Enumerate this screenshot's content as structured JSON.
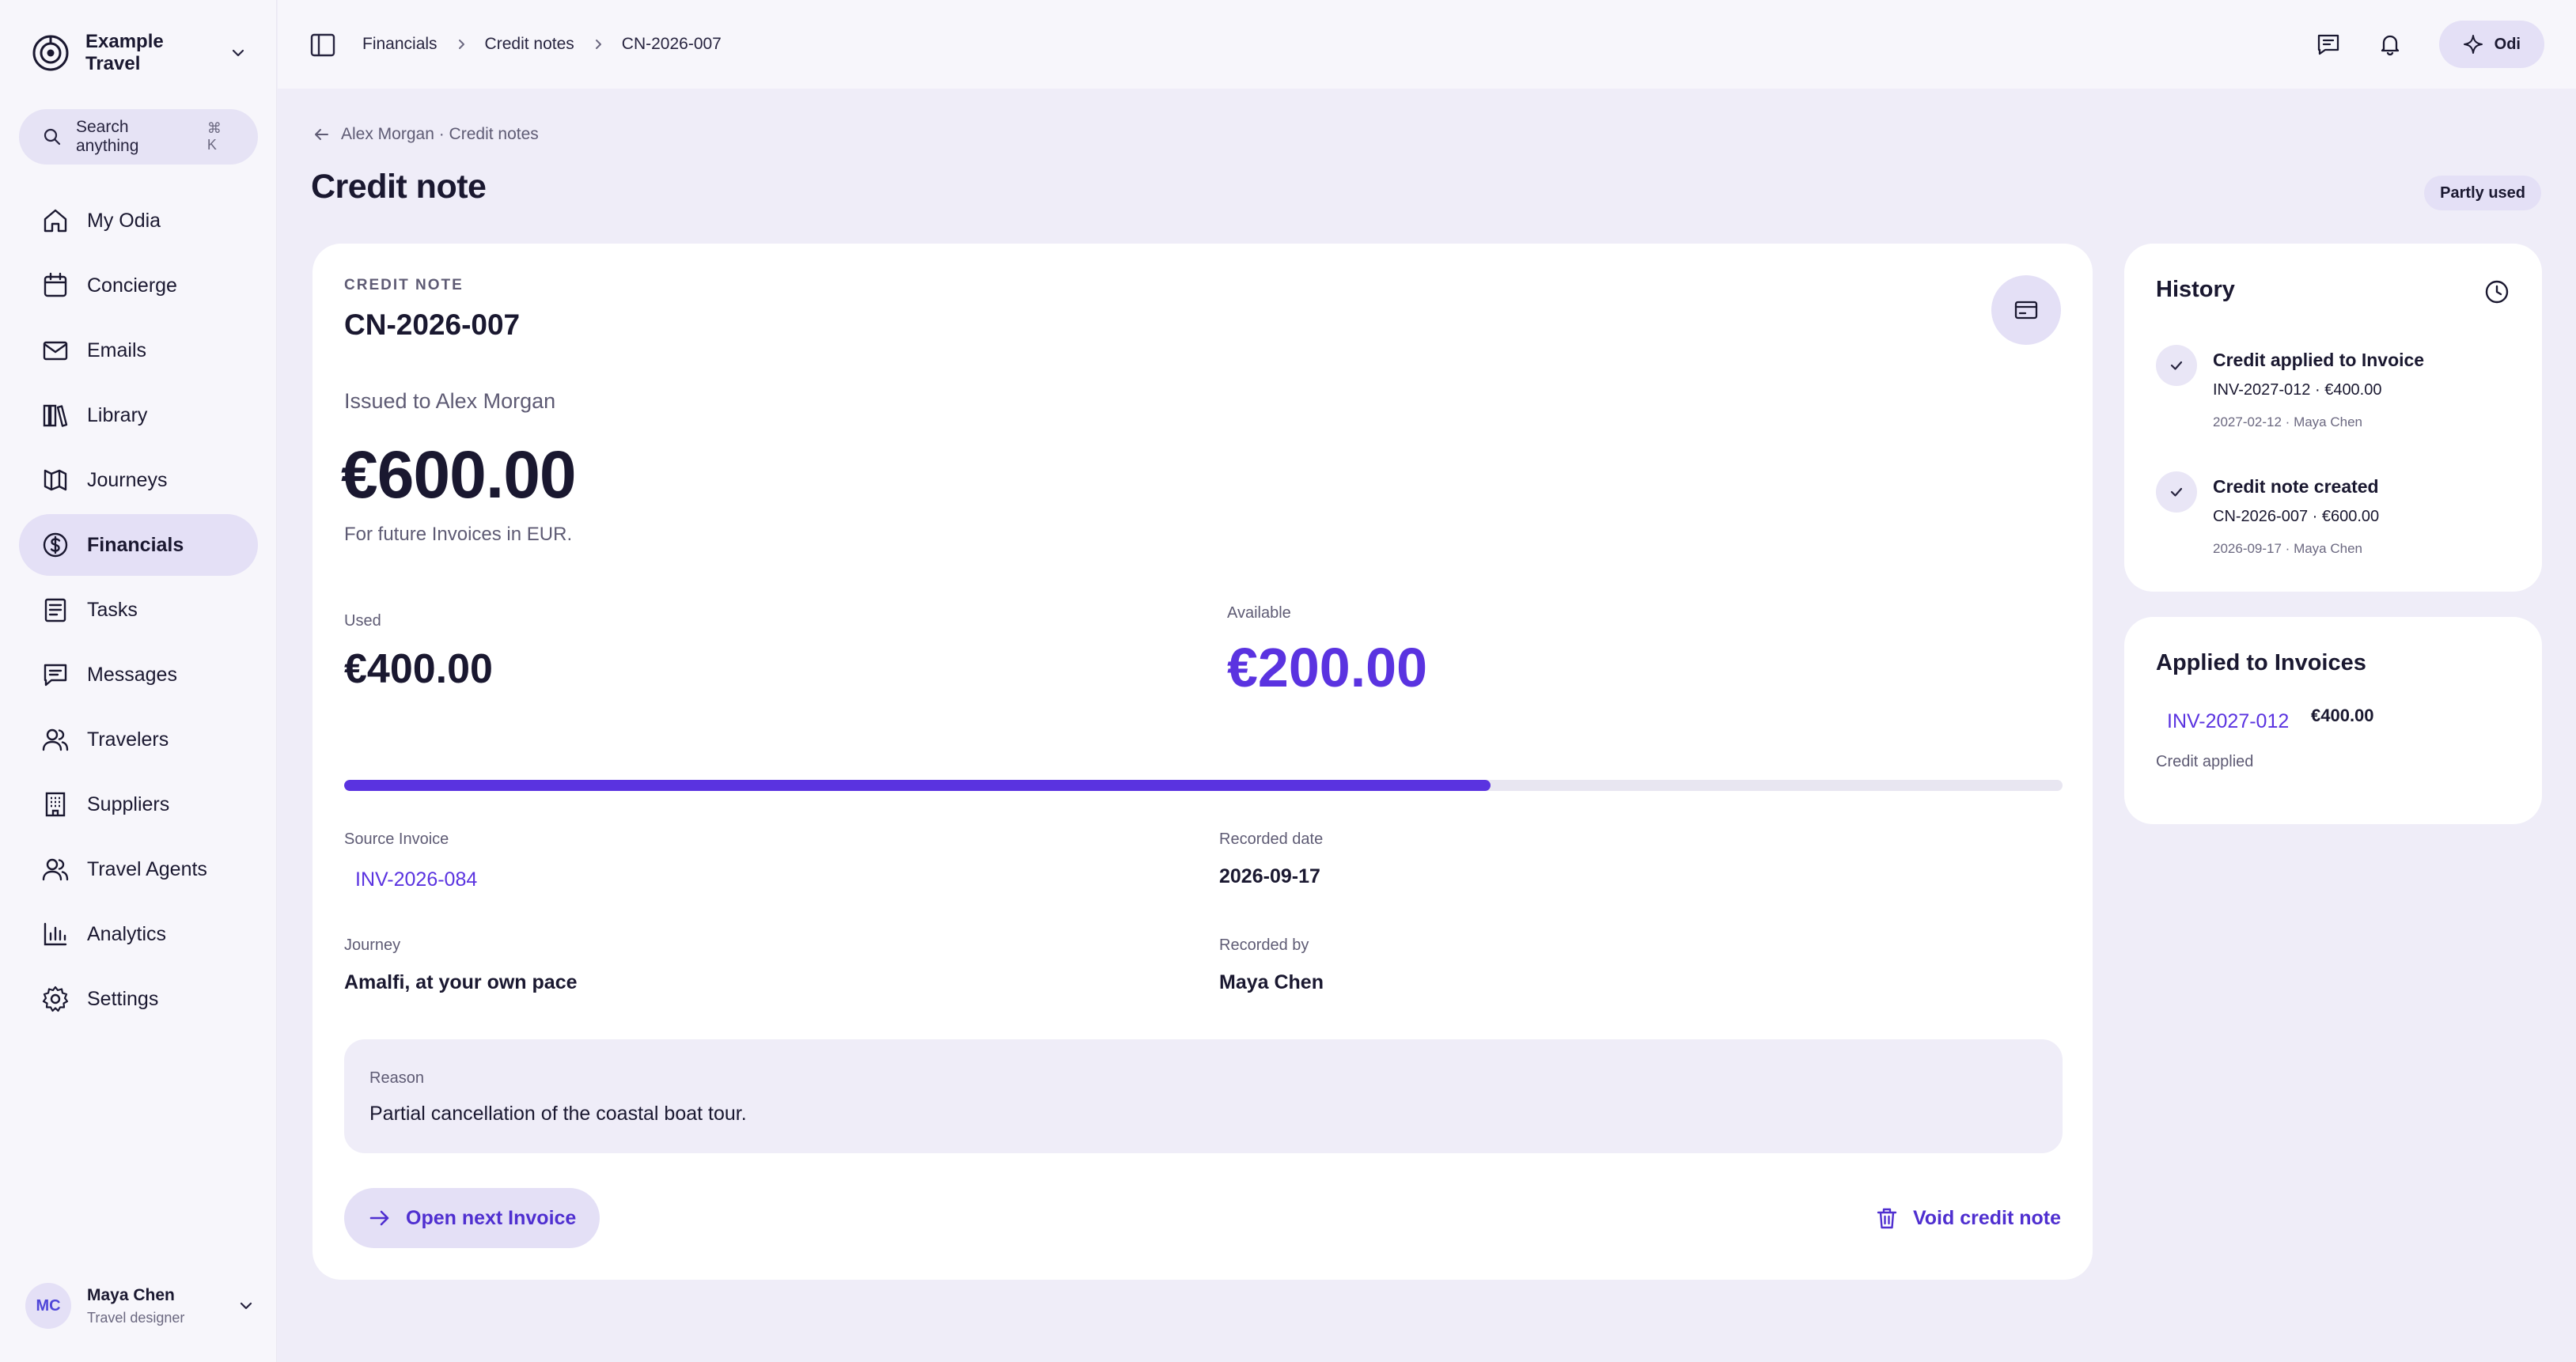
{
  "sidebar": {
    "workspace_name": "Example Travel",
    "search": {
      "label": "Search anything",
      "shortcut": "⌘ K"
    },
    "items": [
      {
        "label": "My Odia",
        "icon": "home-icon"
      },
      {
        "label": "Concierge",
        "icon": "calendar-icon"
      },
      {
        "label": "Emails",
        "icon": "mail-icon"
      },
      {
        "label": "Library",
        "icon": "library-icon"
      },
      {
        "label": "Journeys",
        "icon": "journeys-icon"
      },
      {
        "label": "Financials",
        "icon": "dollar-icon",
        "active": true
      },
      {
        "label": "Tasks",
        "icon": "tasks-icon"
      },
      {
        "label": "Messages",
        "icon": "messages-icon"
      },
      {
        "label": "Travelers",
        "icon": "users-icon"
      },
      {
        "label": "Suppliers",
        "icon": "building-icon"
      },
      {
        "label": "Travel Agents",
        "icon": "agents-icon"
      },
      {
        "label": "Analytics",
        "icon": "chart-icon"
      },
      {
        "label": "Settings",
        "icon": "gear-icon"
      }
    ],
    "user": {
      "initials": "MC",
      "name": "Maya Chen",
      "role": "Travel designer"
    }
  },
  "topbar": {
    "breadcrumbs": [
      "Financials",
      "Credit notes",
      "CN-2026-007"
    ],
    "assistant_label": "Odi"
  },
  "page": {
    "back_link": "Alex Morgan · Credit notes",
    "title": "Credit note",
    "status": "Partly used"
  },
  "credit_note": {
    "eyebrow": "CREDIT NOTE",
    "number": "CN-2026-007",
    "issued_to": "Issued to Alex Morgan",
    "amount": "€600.00",
    "amount_note": "For future Invoices in EUR.",
    "used_label": "Used",
    "used_value": "€400.00",
    "available_label": "Available",
    "available_value": "€200.00",
    "used_fraction": 0.667,
    "source_invoice_label": "Source Invoice",
    "source_invoice": "INV-2026-084",
    "recorded_date_label": "Recorded date",
    "recorded_date": "2026-09-17",
    "journey_label": "Journey",
    "journey": "Amalfi, at your own pace",
    "recorded_by_label": "Recorded by",
    "recorded_by": "Maya Chen",
    "reason_label": "Reason",
    "reason": "Partial cancellation of the coastal boat tour.",
    "next_button": "Open next Invoice",
    "void_button": "Void credit note"
  },
  "history": {
    "title": "History",
    "items": [
      {
        "title": "Credit applied to Invoice",
        "detail": "INV-2027-012 · €400.00",
        "meta": "2027-02-12 · Maya Chen"
      },
      {
        "title": "Credit note created",
        "detail": "CN-2026-007 · €600.00",
        "meta": "2026-09-17 · Maya Chen"
      }
    ]
  },
  "applied": {
    "title": "Applied to Invoices",
    "invoice": "INV-2027-012",
    "amount": "€400.00",
    "note": "Credit applied"
  },
  "colors": {
    "accent": "#5a33e0",
    "accent_soft": "#e4e0f6",
    "background": "#efedf8"
  }
}
